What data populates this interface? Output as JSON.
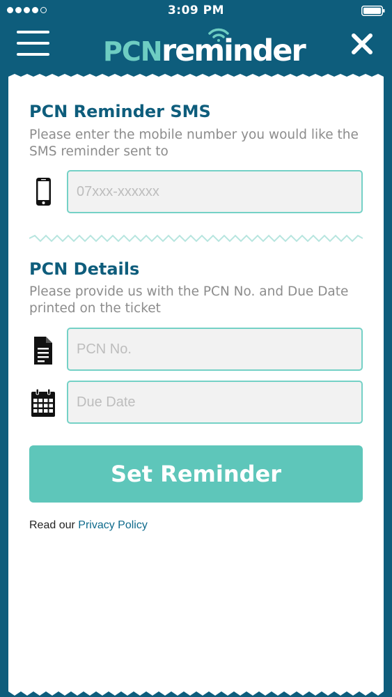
{
  "status_bar": {
    "time": "3:09 PM"
  },
  "header": {
    "logo_pcn": "PCN",
    "logo_reminder": "reminder"
  },
  "sms_section": {
    "title": "PCN Reminder SMS",
    "description": "Please enter the mobile number you would like the SMS reminder sent to",
    "phone_placeholder": "07xxx-xxxxxx",
    "phone_value": ""
  },
  "details_section": {
    "title": "PCN Details",
    "description": "Please provide us with the PCN No. and Due Date printed on the ticket",
    "pcn_placeholder": "PCN No.",
    "due_date_placeholder": "Due Date"
  },
  "submit_label": "Set Reminder",
  "footer": {
    "prefix": "Read our ",
    "privacy_link": "Privacy Policy"
  },
  "colors": {
    "brand_dark": "#0e5d7c",
    "brand_teal": "#5ec6ba",
    "field_border": "#74d1c6"
  },
  "icons": {
    "menu": "hamburger-menu-icon",
    "close": "close-icon",
    "phone": "mobile-phone-icon",
    "document": "document-icon",
    "calendar": "calendar-icon",
    "wifi": "wifi-signal-icon"
  }
}
